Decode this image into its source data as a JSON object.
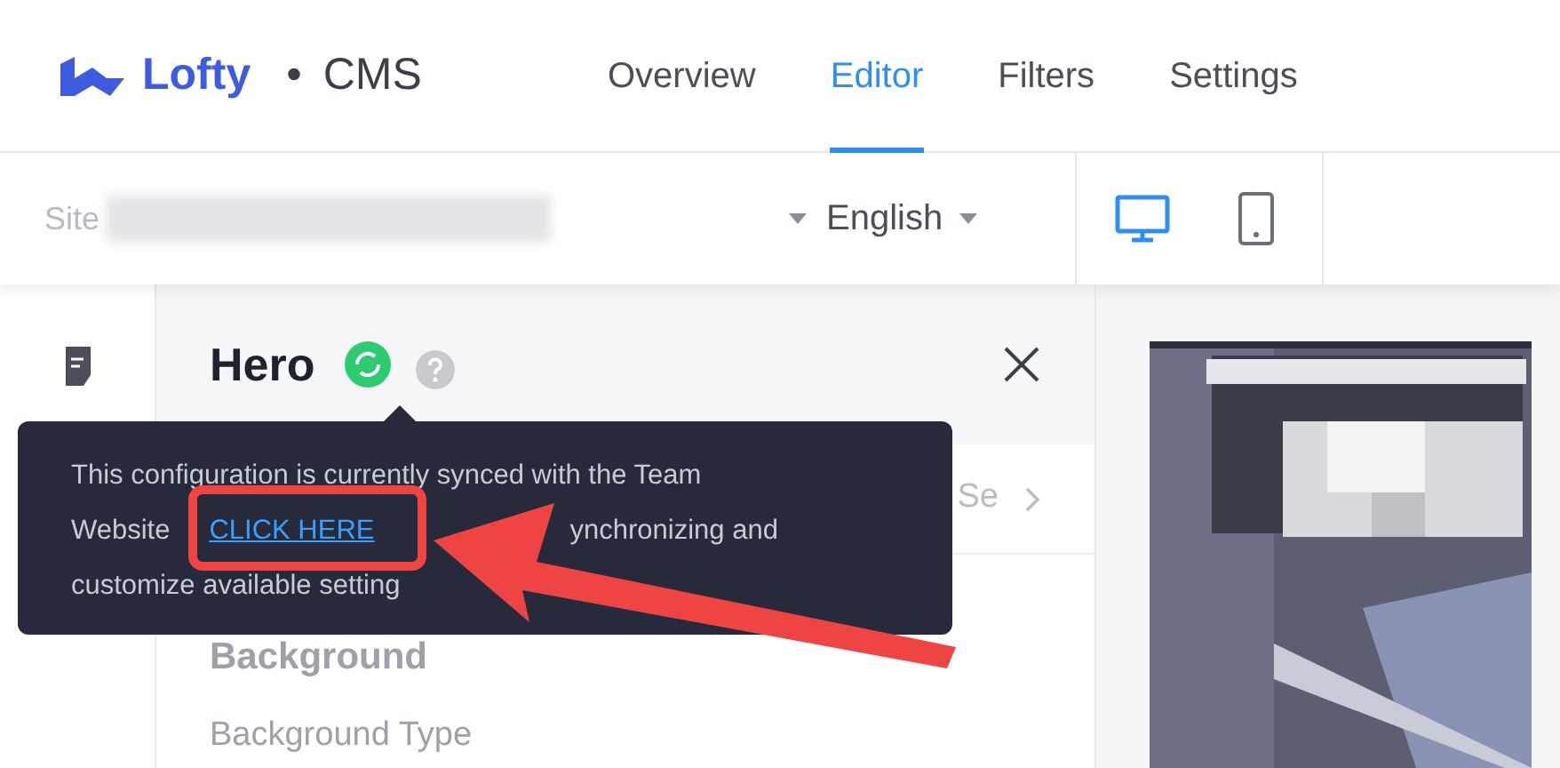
{
  "header": {
    "logo": "Lofty",
    "separator": "•",
    "product": "CMS",
    "tabs": [
      {
        "label": "Overview",
        "selected": false
      },
      {
        "label": "Editor",
        "selected": true
      },
      {
        "label": "Filters",
        "selected": false
      },
      {
        "label": "Settings",
        "selected": false
      }
    ]
  },
  "toolbar": {
    "site_label": "Site",
    "language": "English",
    "devices": [
      {
        "kind": "desktop",
        "selected": true
      },
      {
        "kind": "mobile",
        "selected": false
      }
    ]
  },
  "panel": {
    "title": "Hero",
    "synced": true,
    "row_fragment": "Se",
    "section": "Background",
    "field_label": "Background Type"
  },
  "tooltip": {
    "lines": [
      [
        {
          "kind": "text",
          "text": "This configuration is currently synced with the Team"
        }
      ],
      [
        {
          "kind": "text",
          "text": "Website"
        },
        {
          "kind": "link",
          "text": "CLICK HERE"
        },
        {
          "kind": "text",
          "text": "ynchronizing and"
        }
      ],
      [
        {
          "kind": "text",
          "text": "customize available setting"
        }
      ]
    ]
  },
  "annotation": {
    "highlight": true,
    "arrow": true
  }
}
